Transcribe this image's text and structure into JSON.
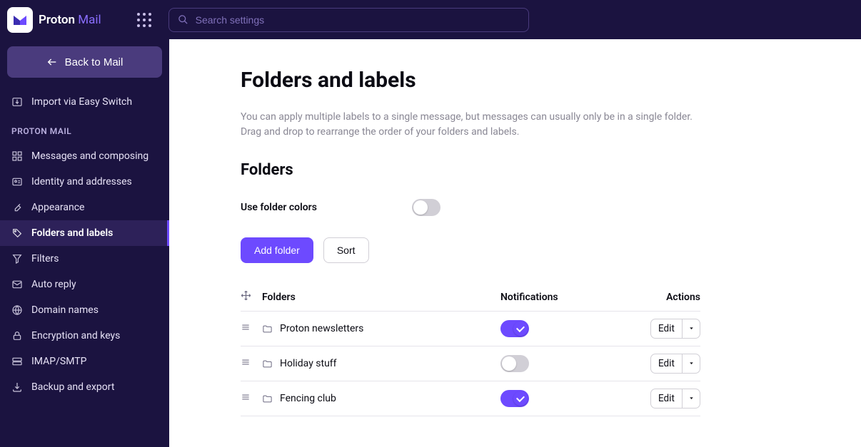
{
  "brand": {
    "name": "Proton",
    "accent": "Mail"
  },
  "search": {
    "placeholder": "Search settings"
  },
  "back_button": "Back to Mail",
  "nav_top": {
    "import": "Import via Easy Switch"
  },
  "section_header": "PROTON MAIL",
  "nav": {
    "messages": "Messages and composing",
    "identity": "Identity and addresses",
    "appearance": "Appearance",
    "folders_labels": "Folders and labels",
    "filters": "Filters",
    "auto_reply": "Auto reply",
    "domain_names": "Domain names",
    "encryption": "Encryption and keys",
    "imap": "IMAP/SMTP",
    "backup": "Backup and export"
  },
  "page": {
    "title": "Folders and labels",
    "description": "You can apply multiple labels to a single message, but messages can usually only be in a single folder. Drag and drop to rearrange the order of your folders and labels.",
    "folders_heading": "Folders",
    "use_colors_label": "Use folder colors",
    "add_folder": "Add folder",
    "sort": "Sort",
    "col_folders": "Folders",
    "col_notifications": "Notifications",
    "col_actions": "Actions",
    "edit_label": "Edit"
  },
  "folders": [
    {
      "name": "Proton newsletters",
      "notifications": true
    },
    {
      "name": "Holiday stuff",
      "notifications": false
    },
    {
      "name": "Fencing club",
      "notifications": true
    }
  ]
}
